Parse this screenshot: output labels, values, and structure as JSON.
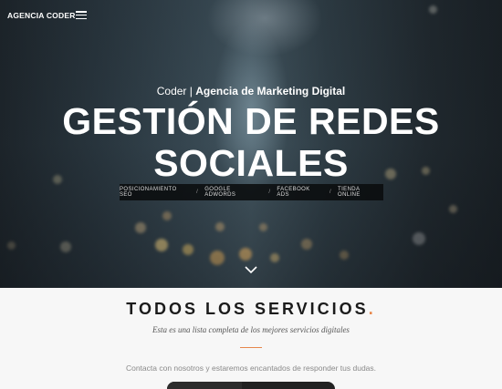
{
  "header": {
    "logo": "AGENCIA CODER",
    "menu_icon": "hamburger-icon"
  },
  "hero": {
    "subtitle_prefix": "Coder | ",
    "subtitle_bold": "Agencia de Marketing Digital",
    "title_line1": "GESTIÓN DE REDES",
    "title_line2": "SOCIALES",
    "services": [
      "POSICIONAMIENTO SEO",
      "GOOGLE ADWORDS",
      "FACEBOOK ADS",
      "TIENDA ONLINE"
    ],
    "separator": "/",
    "scroll_icon": "chevron-down-icon"
  },
  "section": {
    "title": "TODOS LOS SERVICIOS",
    "title_dot": ".",
    "subtitle": "Esta es una lista completa de los mejores servicios digitales",
    "contact_text": "Contacta con nosotros y estaremos encantados de responder tus dudas."
  },
  "colors": {
    "accent": "#e7874b",
    "dark": "#1b1b1b",
    "bar": "#0a0c0e"
  }
}
